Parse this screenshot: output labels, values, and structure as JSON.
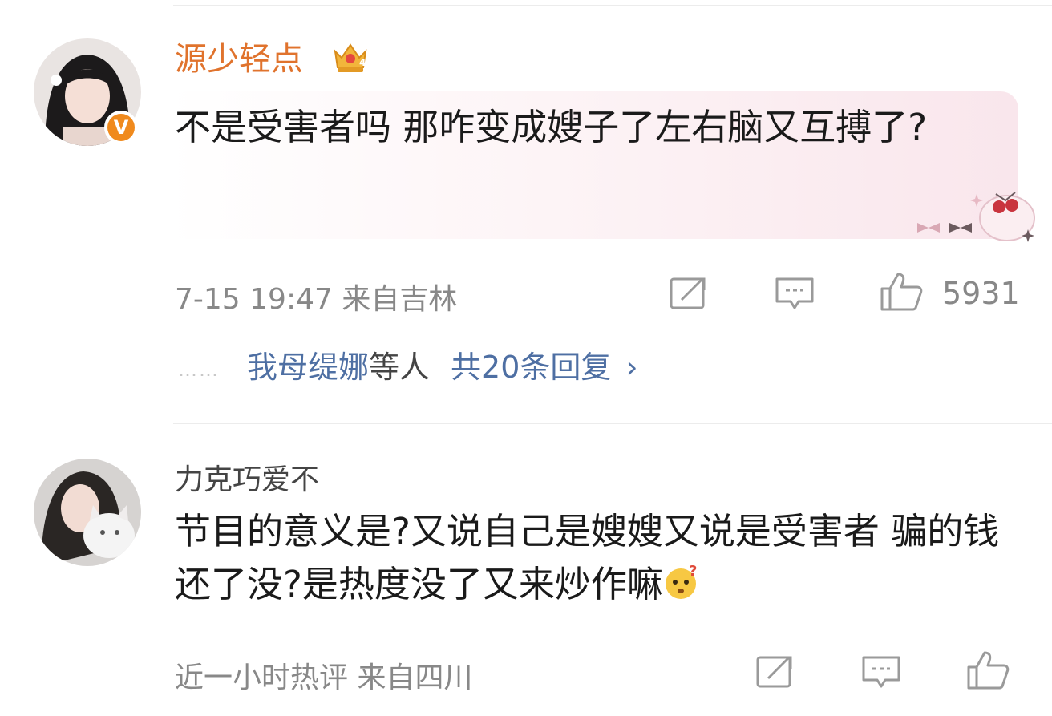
{
  "comments": [
    {
      "username": "源少轻点",
      "crown_icon": "crown-level-4-icon",
      "verified_badge": "V",
      "text": "不是受害者吗 那咋变成嫂子了左右脑又互搏了?",
      "meta": "7-15 19:47 来自吉林",
      "like_count": "5931",
      "replies": {
        "dots": "……",
        "names": "我母缇娜",
        "suffix": "等人",
        "total": "共20条回复",
        "chevron": "›"
      }
    },
    {
      "username": "力克巧爱不",
      "text": "节目的意义是?又说自己是嫂嫂又说是受害者 骗的钱还了没?是热度没了又来炒作嘛",
      "meta": "近一小时热评 来自四川"
    }
  ],
  "colors": {
    "username_vip": "#e0732d",
    "reply_link": "#4e6fa3",
    "meta_text": "#888888",
    "bubble_pink": "#f9e6ec",
    "verified_orange": "#f08a1d"
  }
}
